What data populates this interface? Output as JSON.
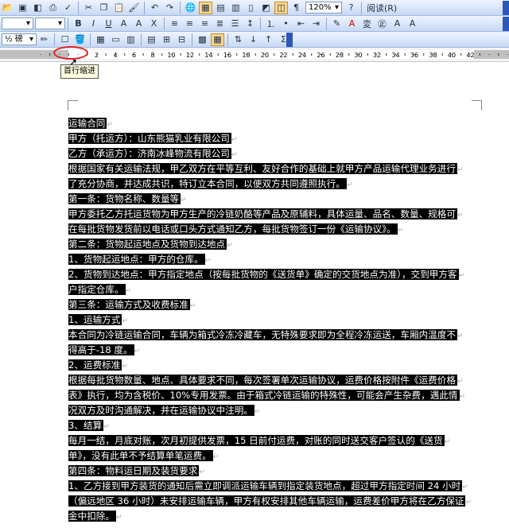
{
  "toolbar": {
    "zoom": "120%",
    "read_label": "阅读(R)",
    "font_size": "½ 磅"
  },
  "ruler": {
    "tooltip": "首行缩进",
    "numbers": [
      "2",
      "4",
      "6",
      "8",
      "10",
      "12",
      "14",
      "16",
      "18",
      "20",
      "22",
      "24",
      "26",
      "28",
      "30",
      "32",
      "34",
      "36",
      "38",
      "40",
      "42"
    ]
  },
  "document": {
    "lines": [
      "运输合同",
      "甲方（托运方）：山东熊猫乳业有限公司",
      "乙方（承运方）：济南冰峰物流有限公司",
      "根据国家有关运输法规，甲乙双方在平等互利、友好合作的基础上就甲方产品运输代理业务进行",
      "了充分协商，并达成共识，特订立本合同，以便双方共同遵照执行。",
      "第一条：货物名称、数量等",
      "甲方委托乙方托运货物为甲方生产的冷链奶酪等产品及原辅料，具体运量、品名、数量、规格可",
      "在每批货物发货前以电话或口头方式通知乙方，每批货物签订一份《运输协议》。",
      "第二条：货物起运地点及货物到达地点",
      "1、货物起运地点：甲方的仓库。",
      "2、货物到达地点：甲方指定地点（按每批货物的《送货单》确定的交货地点为准），交到甲方客",
      "户指定仓库。",
      "第三条：运输方式及收费标准",
      "1、运输方式",
      "本合同为冷链运输合同，车辆为箱式冷冻冷藏车，无特殊要求即为全程冷冻运送，车厢内温度不",
      "得高于-18 度。",
      "2、运费标准",
      "根据每批货物数量、地点、具体要求不同，每次签署单次运输协议，运费价格按附件《运费价格",
      "表》执行，均为含税价、10%专用发票。由于箱式冷链运输的特殊性，可能会产生杂费，遇此情",
      "况双方及时沟通解决，并在运输协议中注明。",
      "3、结算",
      "每月一结，月底对账，次月初提供发票，15 日前付运费，对账的同时送交客户签认的《送货",
      "单》，没有此单不予结算单笔运费。",
      "第四条：物料运日期及装货要求",
      "1、乙方接到甲方装货的通知后需立即调派运输车辆到指定装货地点，超过甲方指定时间 24 小时",
      "（偏远地区 36 小时）未安排运输车辆，甲方有权安排其他车辆运输，运费差价甲方将在乙方保证",
      "金中扣除。"
    ]
  }
}
